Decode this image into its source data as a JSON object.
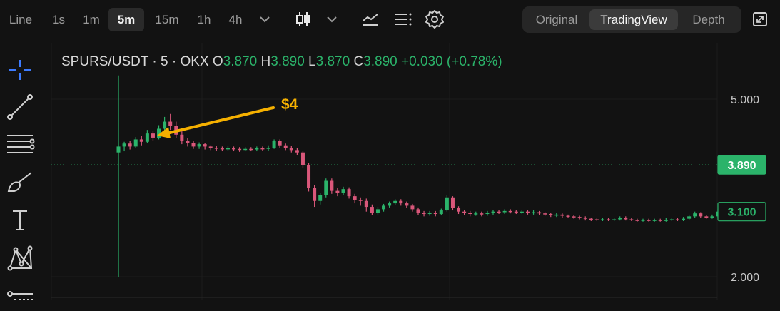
{
  "toolbar": {
    "chart_style_label": "Line",
    "intervals": [
      "1s",
      "1m",
      "5m",
      "15m",
      "1h",
      "4h"
    ],
    "active_interval": "5m",
    "icons": [
      "chevron-down-icon",
      "candlestick-icon",
      "chevron-down-icon",
      "indicator-icon",
      "list-icon",
      "settings-icon",
      "expand-icon"
    ],
    "views": [
      "Original",
      "TradingView",
      "Depth"
    ],
    "active_view": "TradingView"
  },
  "left_tools": [
    "crosshair-icon",
    "trend-line-icon",
    "horizontal-lines-icon",
    "brush-icon",
    "text-icon",
    "pattern-icon",
    "measure-icon"
  ],
  "legend": {
    "symbol": "SPURS/USDT · 5 · OKX",
    "o_label": "O",
    "o_value": "3.870",
    "h_label": "H",
    "h_value": "3.890",
    "l_label": "L",
    "l_value": "3.870",
    "c_label": "C",
    "c_value": "3.890",
    "change": "+0.030 (+0.78%)"
  },
  "annotation": {
    "text": "$4",
    "color": "#f5b000"
  },
  "colors": {
    "up": "#2bb36a",
    "down": "#d9577a",
    "accent": "#f5b000",
    "background": "#121212"
  },
  "chart_data": {
    "type": "candlestick",
    "y_axis": {
      "ticks": [
        5.0,
        2.0
      ],
      "tick_labels": [
        "5.000",
        "2.000"
      ],
      "ylim": [
        1.95,
        5.4
      ]
    },
    "price_tags": [
      {
        "label": "3.890",
        "value": 3.89,
        "style": "filled"
      },
      {
        "label": "3.100",
        "value": 3.1,
        "style": "outline"
      }
    ],
    "candles": [
      [
        4.1,
        4.2,
        2.0,
        5.4
      ],
      [
        4.2,
        4.25,
        4.12,
        4.28
      ],
      [
        4.25,
        4.2,
        4.15,
        4.3
      ],
      [
        4.2,
        4.32,
        4.18,
        4.36
      ],
      [
        4.32,
        4.28,
        4.22,
        4.38
      ],
      [
        4.28,
        4.42,
        4.26,
        4.48
      ],
      [
        4.42,
        4.35,
        4.3,
        4.46
      ],
      [
        4.35,
        4.5,
        4.32,
        4.56
      ],
      [
        4.5,
        4.62,
        4.45,
        4.7
      ],
      [
        4.62,
        4.55,
        4.48,
        4.75
      ],
      [
        4.55,
        4.4,
        4.34,
        4.62
      ],
      [
        4.4,
        4.3,
        4.24,
        4.46
      ],
      [
        4.3,
        4.26,
        4.2,
        4.34
      ],
      [
        4.26,
        4.2,
        4.16,
        4.3
      ],
      [
        4.2,
        4.24,
        4.16,
        4.27
      ],
      [
        4.24,
        4.2,
        4.15,
        4.26
      ],
      [
        4.2,
        4.18,
        4.14,
        4.22
      ],
      [
        4.18,
        4.17,
        4.13,
        4.21
      ],
      [
        4.17,
        4.16,
        4.12,
        4.2
      ],
      [
        4.16,
        4.17,
        4.13,
        4.21
      ],
      [
        4.17,
        4.16,
        4.12,
        4.2
      ],
      [
        4.16,
        4.15,
        4.11,
        4.19
      ],
      [
        4.15,
        4.16,
        4.12,
        4.19
      ],
      [
        4.16,
        4.15,
        4.12,
        4.19
      ],
      [
        4.15,
        4.17,
        4.12,
        4.2
      ],
      [
        4.17,
        4.16,
        4.13,
        4.2
      ],
      [
        4.16,
        4.18,
        4.13,
        4.22
      ],
      [
        4.18,
        4.3,
        4.16,
        4.32
      ],
      [
        4.3,
        4.22,
        4.18,
        4.32
      ],
      [
        4.22,
        4.18,
        4.14,
        4.25
      ],
      [
        4.18,
        4.14,
        4.1,
        4.21
      ],
      [
        4.14,
        4.1,
        4.05,
        4.17
      ],
      [
        4.1,
        3.88,
        3.84,
        4.13
      ],
      [
        3.88,
        3.5,
        3.44,
        3.92
      ],
      [
        3.5,
        3.28,
        3.18,
        3.55
      ],
      [
        3.28,
        3.38,
        3.22,
        3.42
      ],
      [
        3.38,
        3.62,
        3.34,
        3.66
      ],
      [
        3.62,
        3.45,
        3.4,
        3.66
      ],
      [
        3.45,
        3.42,
        3.36,
        3.5
      ],
      [
        3.42,
        3.48,
        3.38,
        3.52
      ],
      [
        3.48,
        3.36,
        3.32,
        3.51
      ],
      [
        3.36,
        3.3,
        3.24,
        3.4
      ],
      [
        3.3,
        3.28,
        3.2,
        3.34
      ],
      [
        3.28,
        3.18,
        3.1,
        3.32
      ],
      [
        3.18,
        3.08,
        3.04,
        3.22
      ],
      [
        3.08,
        3.14,
        3.05,
        3.18
      ],
      [
        3.14,
        3.2,
        3.1,
        3.23
      ],
      [
        3.2,
        3.24,
        3.17,
        3.27
      ],
      [
        3.24,
        3.28,
        3.21,
        3.31
      ],
      [
        3.28,
        3.24,
        3.2,
        3.31
      ],
      [
        3.24,
        3.2,
        3.16,
        3.27
      ],
      [
        3.2,
        3.14,
        3.1,
        3.23
      ],
      [
        3.14,
        3.08,
        3.04,
        3.17
      ],
      [
        3.08,
        3.06,
        3.02,
        3.11
      ],
      [
        3.06,
        3.08,
        3.03,
        3.11
      ],
      [
        3.08,
        3.06,
        3.02,
        3.11
      ],
      [
        3.06,
        3.12,
        3.04,
        3.15
      ],
      [
        3.12,
        3.34,
        3.1,
        3.38
      ],
      [
        3.34,
        3.16,
        3.12,
        3.36
      ],
      [
        3.16,
        3.1,
        3.06,
        3.19
      ],
      [
        3.1,
        3.08,
        3.04,
        3.13
      ],
      [
        3.08,
        3.06,
        3.02,
        3.11
      ],
      [
        3.06,
        3.07,
        3.03,
        3.1
      ],
      [
        3.07,
        3.06,
        3.02,
        3.1
      ],
      [
        3.06,
        3.08,
        3.03,
        3.11
      ],
      [
        3.08,
        3.1,
        3.05,
        3.13
      ],
      [
        3.1,
        3.09,
        3.06,
        3.13
      ],
      [
        3.09,
        3.11,
        3.06,
        3.14
      ],
      [
        3.11,
        3.1,
        3.07,
        3.14
      ],
      [
        3.1,
        3.09,
        3.06,
        3.13
      ],
      [
        3.09,
        3.1,
        3.06,
        3.13
      ],
      [
        3.1,
        3.08,
        3.05,
        3.12
      ],
      [
        3.08,
        3.09,
        3.05,
        3.12
      ],
      [
        3.09,
        3.07,
        3.04,
        3.11
      ],
      [
        3.07,
        3.06,
        3.03,
        3.09
      ],
      [
        3.06,
        3.04,
        3.01,
        3.08
      ],
      [
        3.04,
        3.05,
        3.01,
        3.08
      ],
      [
        3.05,
        3.03,
        3.0,
        3.07
      ],
      [
        3.03,
        3.02,
        2.99,
        3.05
      ],
      [
        3.02,
        3.01,
        2.98,
        3.04
      ],
      [
        3.01,
        3.0,
        2.97,
        3.03
      ],
      [
        3.0,
        2.98,
        2.95,
        3.02
      ],
      [
        2.98,
        2.97,
        2.94,
        3.0
      ],
      [
        2.97,
        2.96,
        2.94,
        2.99
      ],
      [
        2.96,
        2.97,
        2.94,
        3.0
      ],
      [
        2.97,
        2.96,
        2.94,
        2.99
      ],
      [
        2.96,
        2.97,
        2.94,
        3.0
      ],
      [
        2.97,
        3.0,
        2.95,
        3.02
      ],
      [
        3.0,
        2.97,
        2.95,
        3.02
      ],
      [
        2.97,
        2.96,
        2.94,
        2.99
      ],
      [
        2.96,
        2.95,
        2.93,
        2.98
      ],
      [
        2.95,
        2.96,
        2.93,
        2.98
      ],
      [
        2.96,
        2.95,
        2.93,
        2.98
      ],
      [
        2.95,
        2.96,
        2.93,
        2.98
      ],
      [
        2.96,
        2.95,
        2.93,
        2.98
      ],
      [
        2.95,
        2.96,
        2.93,
        2.99
      ],
      [
        2.96,
        2.97,
        2.94,
        3.0
      ],
      [
        2.97,
        2.96,
        2.94,
        2.99
      ],
      [
        2.96,
        2.98,
        2.94,
        3.01
      ],
      [
        2.98,
        3.02,
        2.96,
        3.05
      ],
      [
        3.02,
        3.07,
        2.99,
        3.1
      ],
      [
        3.07,
        3.02,
        2.99,
        3.09
      ],
      [
        3.02,
        3.0,
        2.98,
        3.04
      ],
      [
        3.0,
        3.02,
        2.98,
        3.05
      ],
      [
        3.02,
        3.1,
        3.0,
        3.14
      ]
    ]
  }
}
